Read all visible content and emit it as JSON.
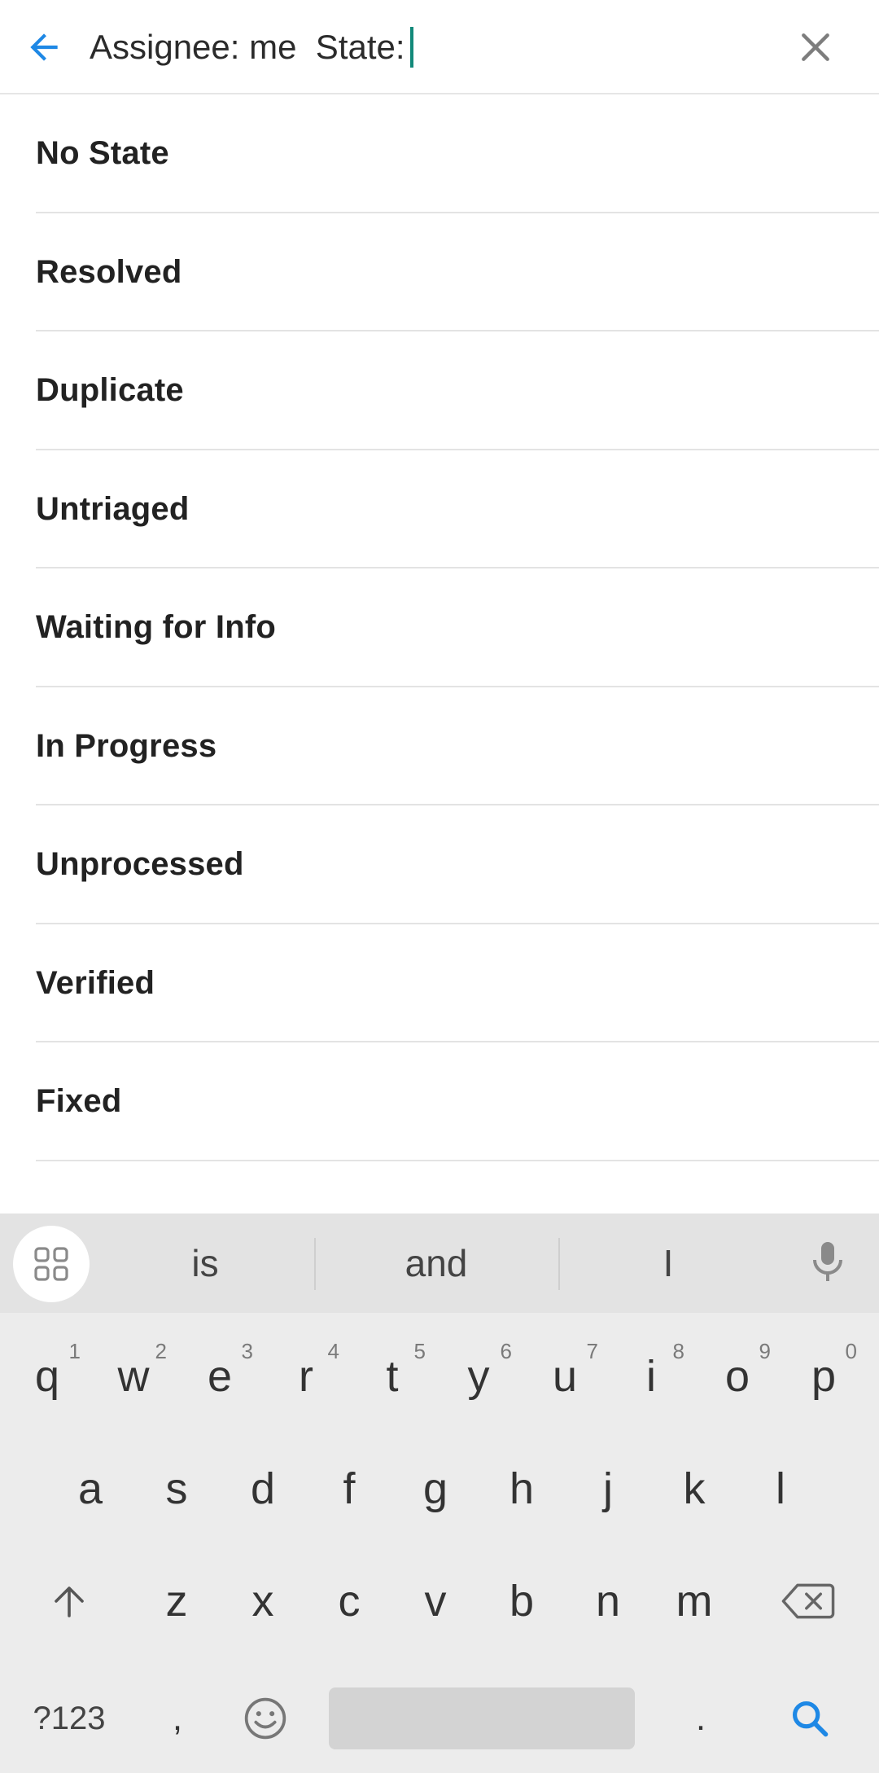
{
  "search": {
    "query_prefix": "Assignee: me  State:"
  },
  "suggestions": [
    {
      "label": "No State"
    },
    {
      "label": "Resolved"
    },
    {
      "label": "Duplicate"
    },
    {
      "label": "Untriaged"
    },
    {
      "label": "Waiting for Info"
    },
    {
      "label": "In Progress"
    },
    {
      "label": "Unprocessed"
    },
    {
      "label": "Verified"
    },
    {
      "label": "Fixed"
    }
  ],
  "keyboard": {
    "word_suggestions": [
      "is",
      "and",
      "I"
    ],
    "row1": [
      {
        "key": "q",
        "hint": "1"
      },
      {
        "key": "w",
        "hint": "2"
      },
      {
        "key": "e",
        "hint": "3"
      },
      {
        "key": "r",
        "hint": "4"
      },
      {
        "key": "t",
        "hint": "5"
      },
      {
        "key": "y",
        "hint": "6"
      },
      {
        "key": "u",
        "hint": "7"
      },
      {
        "key": "i",
        "hint": "8"
      },
      {
        "key": "o",
        "hint": "9"
      },
      {
        "key": "p",
        "hint": "0"
      }
    ],
    "row2": [
      "a",
      "s",
      "d",
      "f",
      "g",
      "h",
      "j",
      "k",
      "l"
    ],
    "row3": [
      "z",
      "x",
      "c",
      "v",
      "b",
      "n",
      "m"
    ],
    "symbols_label": "?123",
    "comma": ",",
    "period": "."
  },
  "colors": {
    "accent_blue": "#1e88e5",
    "cursor_teal": "#12897a",
    "keyboard_bg": "#ececec"
  },
  "icons": [
    "arrow-back-icon",
    "close-icon",
    "apps-grid-icon",
    "microphone-icon",
    "shift-icon",
    "backspace-icon",
    "emoji-icon",
    "search-icon"
  ]
}
